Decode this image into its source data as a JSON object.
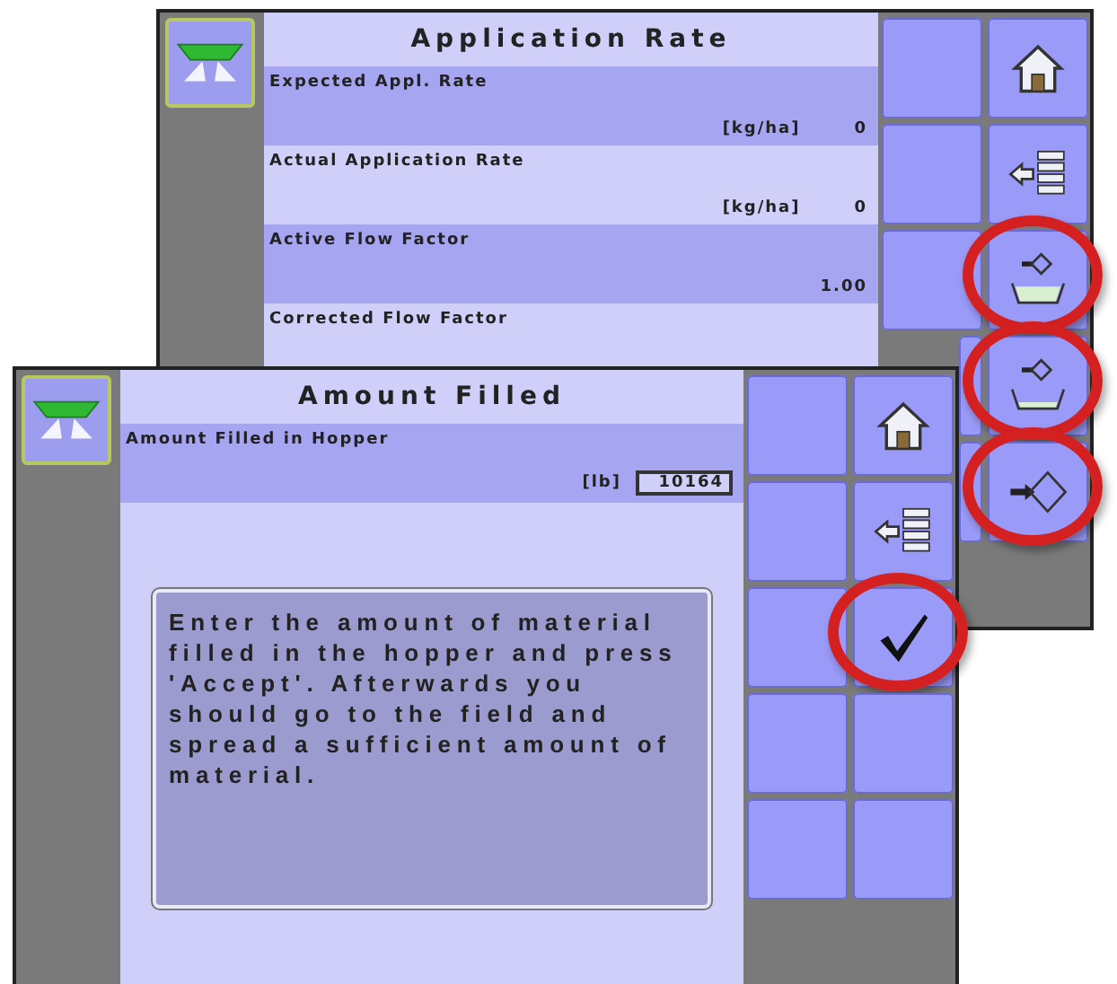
{
  "back_screen": {
    "title": "Application Rate",
    "rows": [
      {
        "label": "Expected Appl. Rate",
        "unit": "[kg/ha]",
        "value": "0"
      },
      {
        "label": "Actual Application Rate",
        "unit": "[kg/ha]",
        "value": "0"
      },
      {
        "label": "Active Flow Factor",
        "value": "1.00"
      },
      {
        "label": "Corrected Flow Factor"
      }
    ],
    "buttons": [
      {
        "kind": "none",
        "highlighted": false
      },
      {
        "kind": "home",
        "highlighted": false
      },
      {
        "kind": "none",
        "highlighted": false
      },
      {
        "kind": "list",
        "highlighted": false
      },
      {
        "kind": "none",
        "highlighted": false
      },
      {
        "kind": "hopper-full",
        "highlighted": true
      },
      {
        "highlighted": false
      },
      {
        "kind": "hopper-low",
        "highlighted": true
      },
      {
        "highlighted": false
      },
      {
        "kind": "arrow-diamond",
        "highlighted": true
      }
    ]
  },
  "front_screen": {
    "title": "Amount Filled",
    "field": {
      "label": "Amount Filled in Hopper",
      "unit": "[lb]",
      "value": "10164"
    },
    "message": "Enter the amount of material filled in the hopper and press 'Accept'. Afterwards you should go to the field and spread a sufficient amount of material.",
    "buttons": [
      {
        "kind": "none",
        "highlighted": false
      },
      {
        "kind": "home",
        "highlighted": false
      },
      {
        "kind": "none",
        "highlighted": false
      },
      {
        "kind": "list",
        "highlighted": false
      },
      {
        "kind": "none",
        "highlighted": false
      },
      {
        "kind": "check",
        "highlighted": true
      },
      {
        "kind": "none",
        "highlighted": false
      },
      {
        "kind": "none",
        "highlighted": false
      },
      {
        "kind": "none",
        "highlighted": false
      },
      {
        "kind": "none",
        "highlighted": false
      }
    ]
  }
}
